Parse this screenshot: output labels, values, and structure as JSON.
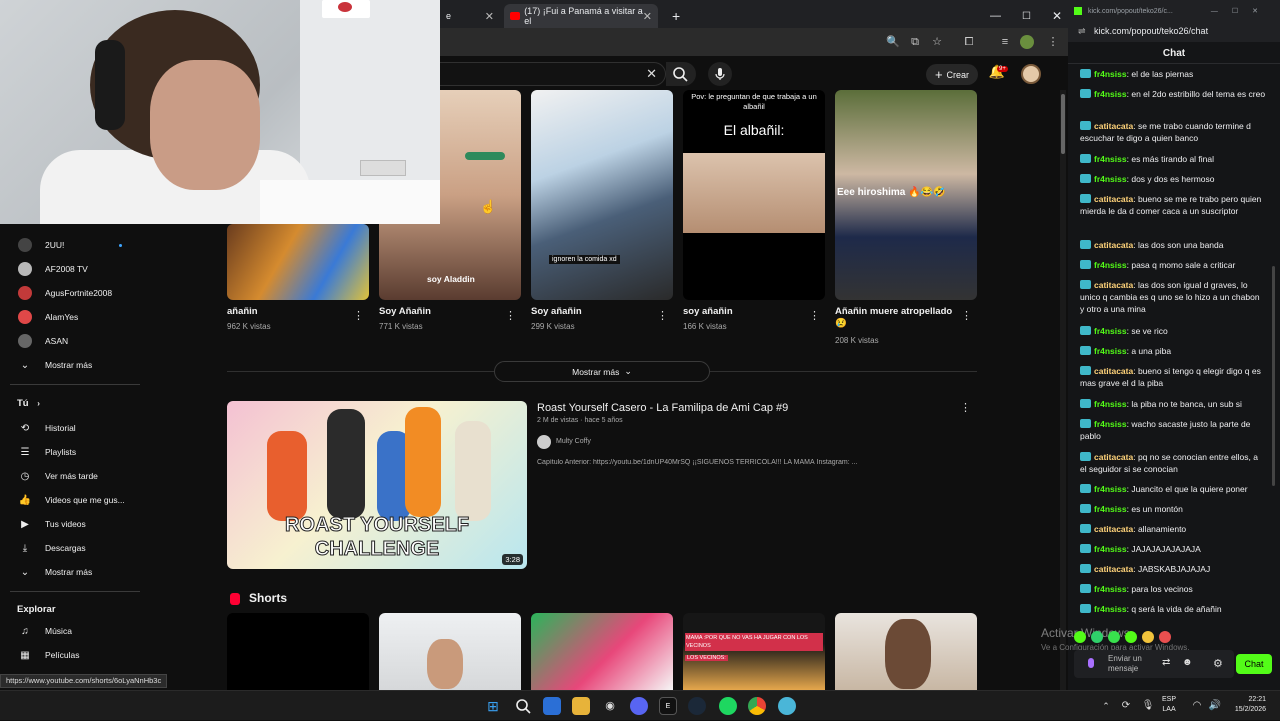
{
  "browser": {
    "tabs": [
      {
        "label": "e"
      },
      {
        "label": "(17) ¡Fui a Panamá a visitar a el"
      }
    ],
    "new_tab": "+",
    "status_url": "https://www.youtube.com/shorts/6oLyaNnHb3c"
  },
  "youtube": {
    "create_label": "Crear",
    "notifications": "9+",
    "shorts_row1": [
      {
        "title": "añañin",
        "views": "962 K vistas"
      },
      {
        "title": "Soy Añañin",
        "views": "771 K vistas",
        "overlay": "soy Aladdin"
      },
      {
        "title": "Soy añañin",
        "views": "299 K vistas",
        "overlay": "ignoren la comida xd"
      },
      {
        "title": "soy añañin",
        "views": "166 K vistas",
        "overlay_top": "Pov: le preguntan de que trabaja a un albañil",
        "overlay_big": "El albañil:"
      },
      {
        "title": "Añañin muere atropellado 😢",
        "views": "208 K vistas",
        "overlay": "Eee hiroshima 🔥😂🤣"
      }
    ],
    "show_more": "Mostrar más",
    "video": {
      "title": "Roast Yourself Casero - La Familipa de Ami Cap #9",
      "meta": "2 M de vistas · hace 5 años",
      "channel": "Multy Coffy",
      "description": "Capítulo Anterior: https://youtu.be/1dnUP40MrSQ ¡¡SIGUENOS TERRÍCOLA!!! LA MAMÁ Instagram: ...",
      "thumb_text_1": "ROAST YOURSELF",
      "thumb_text_2": "CHALLENGE",
      "duration": "3:28"
    },
    "shorts_heading": "Shorts",
    "shorts_row2_overlays": [
      "",
      "",
      "",
      "MAMA :POR QUE NO VAS HA JUGAR CON LOS VECINOS",
      ""
    ],
    "shorts_row2_tag": "LOS VECINOS:"
  },
  "sidebar": {
    "subs": [
      {
        "label": "2UU!"
      },
      {
        "label": "AF2008 TV"
      },
      {
        "label": "AgusFortnite2008"
      },
      {
        "label": "AlamYes"
      },
      {
        "label": "ASAN"
      }
    ],
    "show_more_subs": "Mostrar más",
    "you_heading": "Tú",
    "you_items": [
      {
        "label": "Historial",
        "icon": "history-icon"
      },
      {
        "label": "Playlists",
        "icon": "playlist-icon"
      },
      {
        "label": "Ver más tarde",
        "icon": "clock-icon"
      },
      {
        "label": "Videos que me gus...",
        "icon": "thumbs-up-icon"
      },
      {
        "label": "Tus videos",
        "icon": "video-icon"
      },
      {
        "label": "Descargas",
        "icon": "download-icon"
      },
      {
        "label": "Mostrar más",
        "icon": "chevron-down-icon"
      }
    ],
    "explore_heading": "Explorar",
    "explore_items": [
      {
        "label": "Música",
        "icon": "music-icon"
      },
      {
        "label": "Películas",
        "icon": "film-icon"
      }
    ]
  },
  "chat": {
    "window_url": "kick.com/popout/teko26/c...",
    "url": "kick.com/popout/teko26/chat",
    "title": "Chat",
    "messages": [
      {
        "user": "fr4nsiss",
        "text": "el de las piernas"
      },
      {
        "user": "fr4nsiss",
        "text": "en el 2do estribillo del tema es creo"
      },
      {
        "user": "catitacata",
        "text": "se me trabo cuando termine d escuchar te digo a quien banco"
      },
      {
        "user": "fr4nsiss",
        "text": "es más tirando al final"
      },
      {
        "user": "fr4nsiss",
        "text": "dos y dos es hermoso"
      },
      {
        "user": "catitacata",
        "text": "bueno se me re trabo pero quien mierda le da d comer caca a un suscriptor"
      },
      {
        "user": "catitacata",
        "text": "las dos son una banda"
      },
      {
        "user": "fr4nsiss",
        "text": "pasa q momo sale a criticar"
      },
      {
        "user": "catitacata",
        "text": "las dos son igual d graves, lo unico q cambia es q uno se lo hizo a un chabon y otro a una mina"
      },
      {
        "user": "fr4nsiss",
        "text": "se ve rico"
      },
      {
        "user": "fr4nsiss",
        "text": "a una piba"
      },
      {
        "user": "catitacata",
        "text": "bueno si tengo q elegir digo q es mas grave el d la piba"
      },
      {
        "user": "fr4nsiss",
        "text": "la piba no te banca, un sub si"
      },
      {
        "user": "fr4nsiss",
        "text": "wacho sacaste justo la parte de pablo"
      },
      {
        "user": "catitacata",
        "text": "pq no se conocian entre ellos, a el seguidor si se conocian"
      },
      {
        "user": "fr4nsiss",
        "text": "Juancito el que la quiere poner"
      },
      {
        "user": "fr4nsiss",
        "text": "es un montón"
      },
      {
        "user": "catitacata",
        "text": "allanamiento"
      },
      {
        "user": "fr4nsiss",
        "text": "JAJAJAJAJAJAJA"
      },
      {
        "user": "catitacata",
        "text": "JABSKABJAJAJAJ"
      },
      {
        "user": "fr4nsiss",
        "text": "para los vecinos"
      },
      {
        "user": "fr4nsiss",
        "text": "q será la vida de añañin"
      }
    ],
    "input_placeholder": "Enviar un mensaje",
    "send_label": "Chat",
    "watermark_1": "Activar Windows",
    "watermark_2": "Ve a Configuración para activar Windows."
  },
  "taskbar": {
    "lang_1": "ESP",
    "lang_2": "LAA",
    "time": "22:21",
    "date": "15/2/2026"
  }
}
